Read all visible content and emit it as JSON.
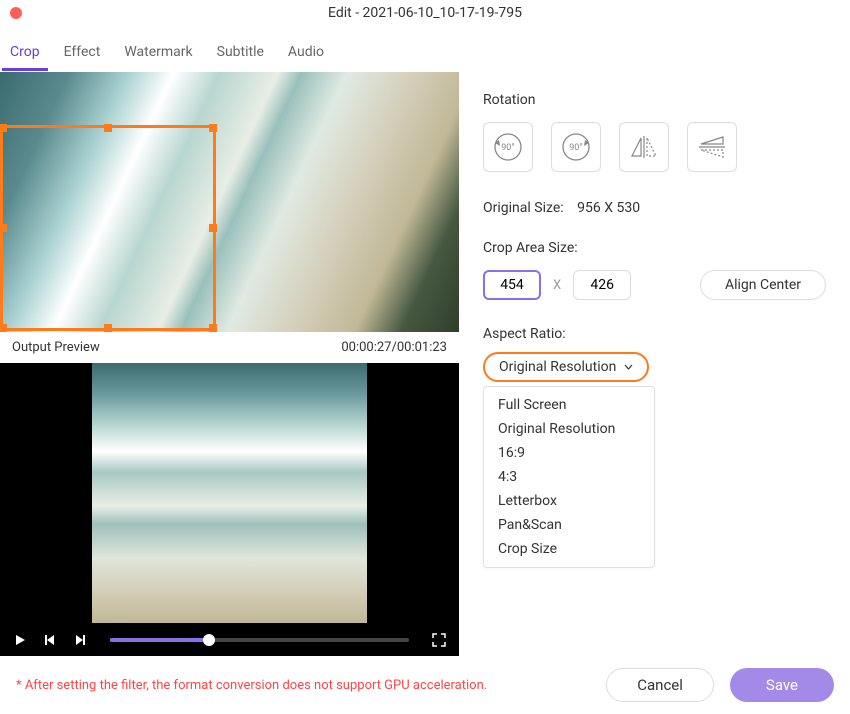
{
  "window": {
    "title": "Edit - 2021-06-10_10-17-19-795"
  },
  "tabs": {
    "crop": "Crop",
    "effect": "Effect",
    "watermark": "Watermark",
    "subtitle": "Subtitle",
    "audio": "Audio"
  },
  "preview": {
    "output_label": "Output Preview",
    "timecode": "00:00:27/00:01:23"
  },
  "rotation": {
    "label": "Rotation",
    "rotate_left": "90°",
    "rotate_right": "90°"
  },
  "original_size": {
    "label": "Original Size:",
    "value": "956 X 530"
  },
  "crop_area": {
    "label": "Crop Area Size:",
    "width": "454",
    "height": "426",
    "separator": "X",
    "align_center": "Align Center"
  },
  "aspect_ratio": {
    "label": "Aspect Ratio:",
    "selected": "Original Resolution",
    "options": {
      "full_screen": "Full Screen",
      "original_resolution": "Original Resolution",
      "r16_9": "16:9",
      "r4_3": "4:3",
      "letterbox": "Letterbox",
      "panscan": "Pan&Scan",
      "crop_size": "Crop Size"
    }
  },
  "footer": {
    "gpu_note": "* After setting the filter, the format conversion does not support GPU acceleration.",
    "cancel": "Cancel",
    "save": "Save"
  }
}
